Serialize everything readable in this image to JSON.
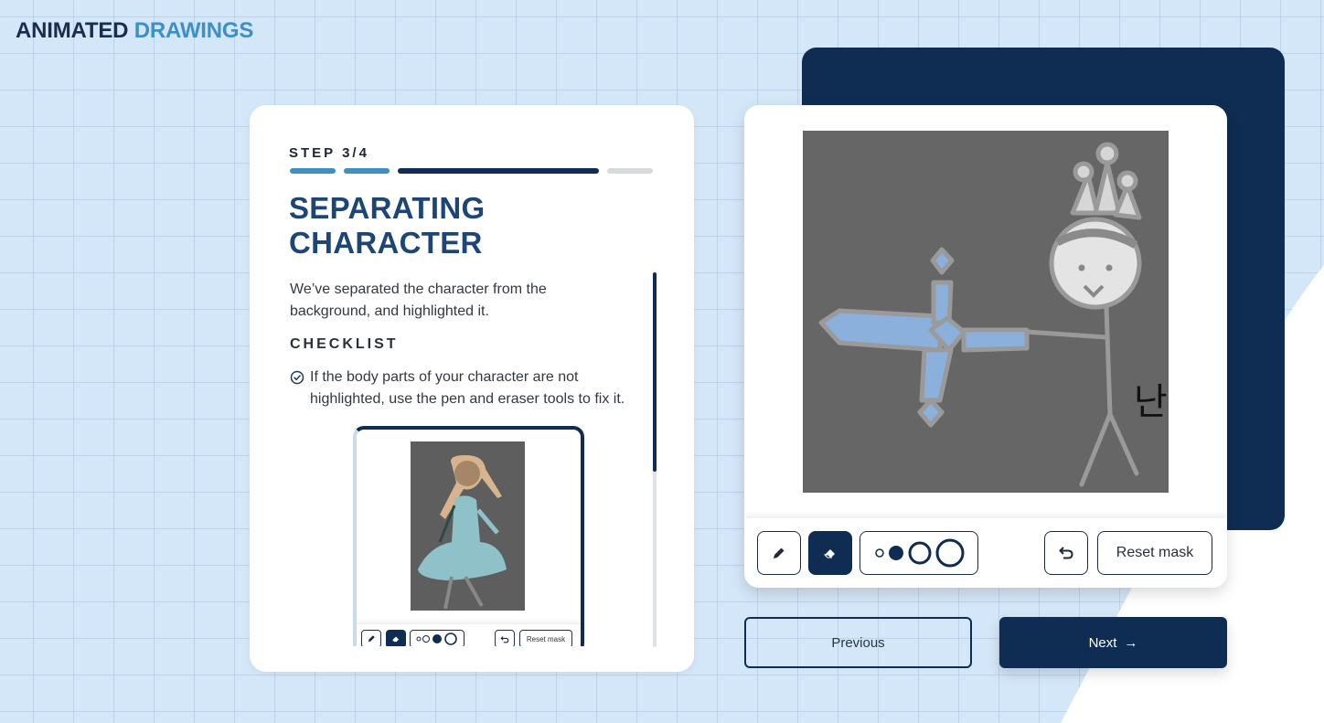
{
  "brand": {
    "part1": "ANIMATED",
    "part2": "DRAWINGS"
  },
  "colors": {
    "primary_dark": "#0f2c52",
    "accent_blue": "#3d8fc6",
    "title_blue": "#1d4676",
    "progress_inactive": "#d6d9de",
    "background": "#d4e7f8"
  },
  "step": {
    "label": "STEP 3/4",
    "current": 3,
    "total": 4,
    "segments": [
      "complete",
      "complete",
      "current",
      "pending"
    ]
  },
  "content": {
    "title_line1": "SEPARATING",
    "title_line2": "CHARACTER",
    "description": "We’ve separated the character from the background, and highlighted it.",
    "checklist_heading": "CHECKLIST",
    "checklist_items": [
      {
        "icon": "check-circle-icon",
        "text": "If the body parts of your character are not highlighted, use the pen and eraser tools to fix it."
      }
    ],
    "scroll_position_fraction": 0.0,
    "scroll_visible_fraction": 0.53
  },
  "preview": {
    "description": "Example drawing of a girl with blonde hair and a light blue dress, with editing toolbar",
    "toolbar": {
      "reset_label": "Reset mask"
    }
  },
  "editor": {
    "canvas_description": "Stick figure with a crown holding a blue sword on a gray background; partial Korean character at right edge",
    "partial_text": "난",
    "tools": [
      {
        "name": "pen",
        "icon": "pencil-icon",
        "active": false
      },
      {
        "name": "eraser",
        "icon": "eraser-icon",
        "active": true
      }
    ],
    "brush_sizes": [
      "xs",
      "sm",
      "md",
      "lg"
    ],
    "selected_brush_size": "sm",
    "undo_icon": "undo-icon",
    "reset_label": "Reset mask"
  },
  "navigation": {
    "previous_label": "Previous",
    "next_label": "Next",
    "next_icon": "arrow-right-icon",
    "next_arrow": "→"
  }
}
